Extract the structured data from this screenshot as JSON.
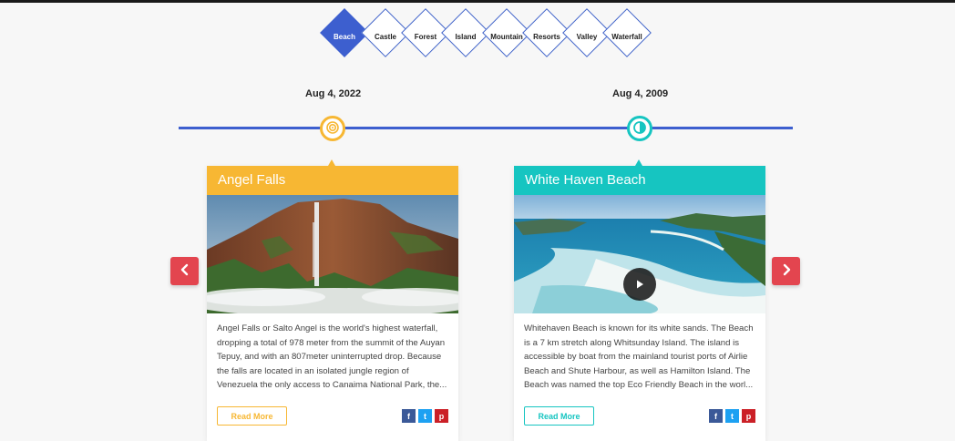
{
  "categories": [
    {
      "label": "Beach",
      "active": true
    },
    {
      "label": "Castle",
      "active": false
    },
    {
      "label": "Forest",
      "active": false
    },
    {
      "label": "Island",
      "active": false
    },
    {
      "label": "Mountain",
      "active": false
    },
    {
      "label": "Resorts",
      "active": false
    },
    {
      "label": "Valley",
      "active": false
    },
    {
      "label": "Waterfall",
      "active": false
    }
  ],
  "timeline": {
    "dates": [
      "Aug 4, 2022",
      "Aug 4, 2009"
    ]
  },
  "cards": [
    {
      "title": "Angel Falls",
      "text": "Angel Falls or Salto Angel is the world's highest waterfall, dropping a total of 978 meter from the summit of the Auyan Tepuy, and with an 807meter uninterrupted drop. Because the falls are located in an isolated jungle region of Venezuela the only access to Canaima National Park, the...",
      "read_more": "Read More",
      "accent": "#f7b733"
    },
    {
      "title": "White Haven Beach",
      "text": "Whitehaven Beach is known for its white sands. The Beach is a 7 km stretch along Whitsunday Island. The island is accessible by boat from the mainland tourist ports of Airlie Beach and Shute Harbour, as well as Hamilton Island. The Beach was named the top Eco Friendly Beach in the worl...",
      "read_more": "Read More",
      "accent": "#16c5c1"
    }
  ],
  "social": {
    "facebook": "f",
    "twitter": "t",
    "pinterest": "p"
  },
  "colors": {
    "primary": "#3d5fcf",
    "arrow": "#e3454f",
    "facebook": "#3b5998",
    "twitter": "#1da1f2",
    "pinterest": "#cb2027"
  },
  "icons": {
    "prev": "chevron-left-icon",
    "next": "chevron-right-icon",
    "node1": "target-icon",
    "node2": "contrast-icon",
    "play": "play-icon"
  }
}
